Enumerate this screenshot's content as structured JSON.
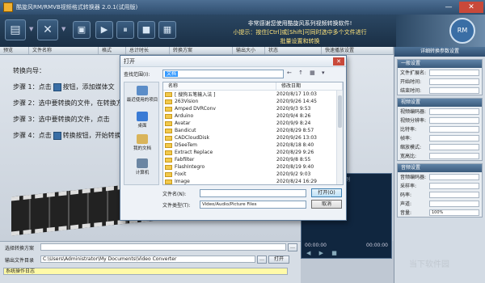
{
  "window": {
    "title": "酷旋风RM/RMVB视频格式转换器 2.0.1(试用版)",
    "min_glyph": "—",
    "close_glyph": "✕"
  },
  "toolbar": {
    "buttons": [
      {
        "name": "add-file-icon",
        "glyph": "▤"
      },
      {
        "name": "remove-icon",
        "glyph": "✕"
      },
      {
        "name": "play-icon",
        "glyph": "▶"
      },
      {
        "name": "pause-icon",
        "glyph": "⏸"
      },
      {
        "name": "stop-icon",
        "glyph": "■"
      },
      {
        "name": "screen-icon",
        "glyph": "▣"
      },
      {
        "name": "settings-icon",
        "glyph": "▦"
      }
    ],
    "dropdown_glyph": "▼",
    "banner_line1": "非常感谢您使用酷旋风系列视频转换软件!",
    "banner_line2": "小提示：按住[Ctrl]或[Shift]可同时选中多个文件进行批量设置和转换",
    "logo_badge": "RM"
  },
  "file_columns": [
    "预览",
    "文件名称",
    "格式",
    "总计时长",
    "转换方案",
    "输出大小",
    "状态",
    "快速播放设置"
  ],
  "guide": {
    "heading": "转换向导：",
    "step1_a": "步骤 1：点击",
    "step1_b": "按钮，添加媒体文",
    "step2": "步骤 2：选中要转换的文件，在转换方",
    "step3": "步骤 3：选中要转换的文件，点击",
    "step4_a": "步骤 4：点击",
    "step4_b": "转换按钮，开始转换"
  },
  "right_panel": {
    "header": "详细转换参数设置",
    "sections": [
      {
        "title": "一般设置",
        "rows": [
          [
            "文件扩展名:",
            ""
          ],
          [
            "开始时间:",
            ""
          ],
          [
            "结束时间:",
            ""
          ]
        ]
      },
      {
        "title": "视频设置",
        "rows": [
          [
            "视频编码器:",
            ""
          ],
          [
            "视频分辨率:",
            ""
          ],
          [
            "比特率:",
            ""
          ],
          [
            "帧率:",
            ""
          ],
          [
            "缩放模式:",
            ""
          ],
          [
            "宽高比:",
            ""
          ]
        ]
      },
      {
        "title": "音频设置",
        "rows": [
          [
            "音频编码器:",
            ""
          ],
          [
            "采样率:",
            ""
          ],
          [
            "码率:",
            ""
          ],
          [
            "声道:",
            ""
          ],
          [
            "音量:",
            "100%"
          ]
        ]
      }
    ]
  },
  "preview": {
    "title": "原始比例",
    "time_start": "00:00:00",
    "time_end": "00:00:00",
    "controls": "◀ ▶ ■"
  },
  "bottom": {
    "scheme_label": "选择转换方案",
    "output_label": "输出文件目录",
    "output_path": "C:\\Users\\Administrator\\My Documents\\Video Converter",
    "open_button": "打开",
    "log_label": "系统操作日志",
    "browse_glyph": "…"
  },
  "dialog": {
    "title": "打开",
    "close_glyph": "✕",
    "lookin_label": "查找范围(I):",
    "lookin_value": "文档",
    "nav_icons": "← ↑ ▦ ▾",
    "places": [
      {
        "label": "最近使用的项目",
        "color": "#5b8dc8"
      },
      {
        "label": "桌面",
        "color": "#3a7bd5"
      },
      {
        "label": "我的文档",
        "color": "#d9b45a"
      },
      {
        "label": "计算机",
        "color": "#6b86a3"
      }
    ],
    "columns": [
      "名称",
      "修改日期"
    ],
    "files": [
      {
        "name": "[ 搜狗五笔输入法 ]",
        "date": "2020/8/17 10:03"
      },
      {
        "name": "263Vision",
        "date": "2020/9/26 14:45"
      },
      {
        "name": "Amped DVRConv",
        "date": "2020/9/3 9:53"
      },
      {
        "name": "Arduino",
        "date": "2020/9/4 8:26"
      },
      {
        "name": "Avatar",
        "date": "2020/9/9 8:24"
      },
      {
        "name": "Bandicut",
        "date": "2020/8/29 8:57"
      },
      {
        "name": "CADCloudDisk",
        "date": "2020/9/26 13:03"
      },
      {
        "name": "DSeeTem",
        "date": "2020/8/18 8:40"
      },
      {
        "name": "Extract Replace",
        "date": "2020/8/29 9:26"
      },
      {
        "name": "Fabfilter",
        "date": "2020/9/8 8:55"
      },
      {
        "name": "FlashIntegro",
        "date": "2020/8/19 9:40"
      },
      {
        "name": "Foxit",
        "date": "2020/9/2 9:03"
      },
      {
        "name": "Image",
        "date": "2020/8/24 16:29"
      }
    ],
    "filename_label": "文件名(N):",
    "filename_value": "",
    "filetype_label": "文件类型(T):",
    "filetype_value": "Video/Audio/Picture Files",
    "open_button": "打开(O)",
    "cancel_button": "取消"
  },
  "watermark": "当下软件园"
}
